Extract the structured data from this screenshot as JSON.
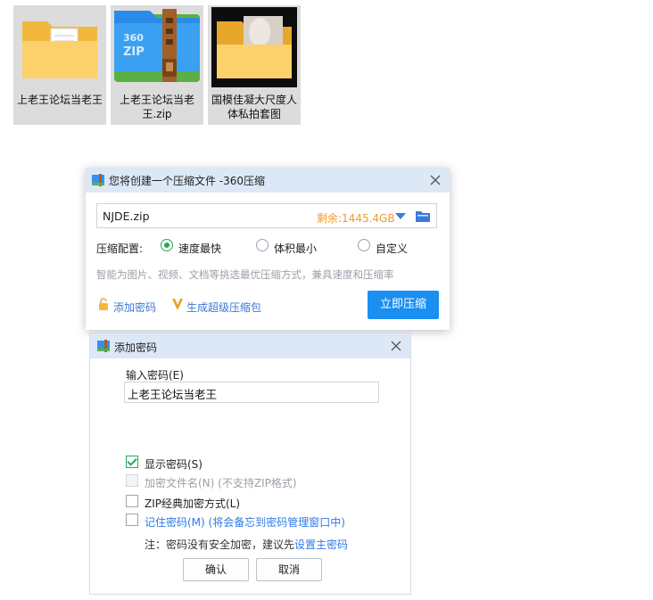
{
  "desktop": {
    "icons": [
      {
        "label": "上老王论坛当老王",
        "kind": "folder"
      },
      {
        "label": "上老王论坛当老王.zip",
        "kind": "zip",
        "badge": "360 ZIP"
      },
      {
        "label": "国模佳凝大尺度人体私拍套图",
        "kind": "photo-folder"
      }
    ]
  },
  "compress_dialog": {
    "title": "您将创建一个压缩文件 -360压缩",
    "file_name": "NJDE.zip",
    "free_space": "剩余:1445.4GB",
    "config_label": "压缩配置:",
    "options": [
      {
        "label": "速度最快",
        "selected": true
      },
      {
        "label": "体积最小",
        "selected": false
      },
      {
        "label": "自定义",
        "selected": false
      }
    ],
    "hint": "智能为图片、视频、文档等挑选最优压缩方式，兼具速度和压缩率",
    "add_password_link": "添加密码",
    "super_package_link": "生成超级压缩包",
    "compress_button": "立即压缩"
  },
  "password_dialog": {
    "title": "添加密码",
    "input_label": "输入密码(E)",
    "password_value": "上老王论坛当老王",
    "checkboxes": [
      {
        "label": "显示密码(S)",
        "checked": true,
        "disabled": false,
        "style": "normal"
      },
      {
        "label": "加密文件名(N) (不支持ZIP格式)",
        "checked": false,
        "disabled": true,
        "style": "disabled"
      },
      {
        "label": "ZIP经典加密方式(L)",
        "checked": false,
        "disabled": false,
        "style": "normal"
      },
      {
        "label": "记住密码(M) (将会备忘到密码管理窗口中)",
        "checked": false,
        "disabled": false,
        "style": "link"
      }
    ],
    "note_prefix": "注：密码没有安全加密，建议先",
    "note_link": "设置主密码",
    "ok_button": "确认",
    "cancel_button": "取消"
  },
  "colors": {
    "accent": "#1a8ff0",
    "title_bar": "#dde8f6",
    "free_space": "#f09a2a",
    "radio_on": "#25a85a",
    "link": "#2c7be5"
  }
}
